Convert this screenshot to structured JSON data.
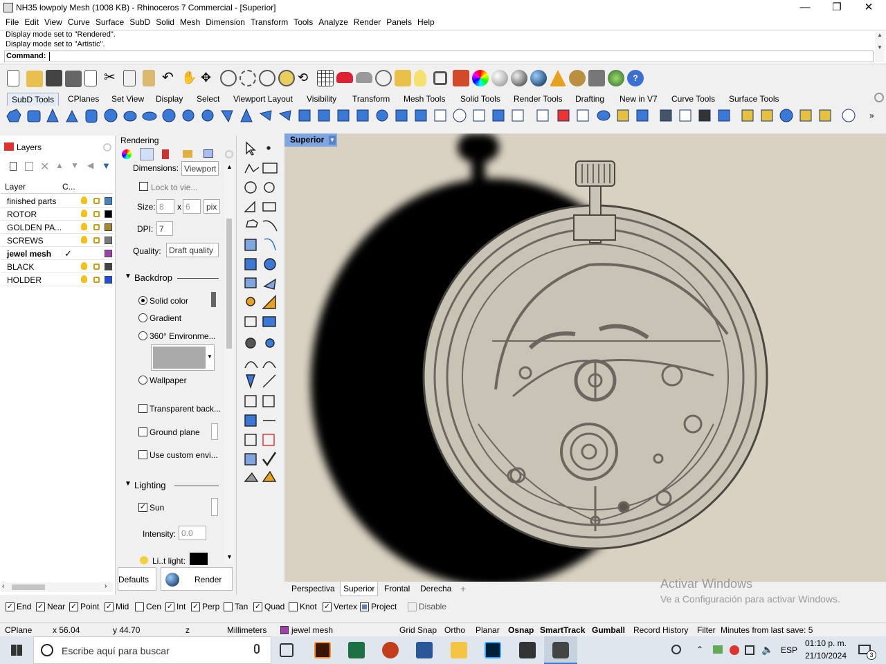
{
  "window": {
    "title": "NH35 lowpoly Mesh (1008 KB) - Rhinoceros 7 Commercial - [Superior]",
    "minimize_glyph": "—",
    "maximize_glyph": "❐",
    "close_glyph": "✕"
  },
  "menu": [
    "File",
    "Edit",
    "View",
    "Curve",
    "Surface",
    "SubD",
    "Solid",
    "Mesh",
    "Dimension",
    "Transform",
    "Tools",
    "Analyze",
    "Render",
    "Panels",
    "Help"
  ],
  "command": {
    "history": [
      "Display mode set to \"Rendered\".",
      "Display mode set to \"Artistic\"."
    ],
    "label": "Command:",
    "value": ""
  },
  "toolbar_tabs": [
    "SubD Tools",
    "CPlanes",
    "Set View",
    "Display",
    "Select",
    "Viewport Layout",
    "Visibility",
    "Transform",
    "Mesh Tools",
    "Solid Tools",
    "Render Tools",
    "Drafting",
    "New in V7",
    "Curve Tools",
    "Surface Tools"
  ],
  "layers": {
    "panel_title": "Layers",
    "col_layer": "Layer",
    "col_c": "C...",
    "items": [
      {
        "name": "finished parts",
        "color": "#3c87c4",
        "current": false
      },
      {
        "name": "ROTOR",
        "color": "#000000",
        "current": false
      },
      {
        "name": "GOLDEN PA...",
        "color": "#a88a2c",
        "current": false
      },
      {
        "name": "SCREWS",
        "color": "#7a7a7a",
        "current": false
      },
      {
        "name": "jewel mesh",
        "color": "#a040b0",
        "current": true
      },
      {
        "name": "BLACK",
        "color": "#444444",
        "current": false
      },
      {
        "name": "HOLDER",
        "color": "#1e50e0",
        "current": false
      }
    ],
    "check_glyph": "✓"
  },
  "rendering": {
    "title": "Rendering",
    "dimensions_label": "Dimensions:",
    "dimensions_value": "Viewport",
    "lock_label": "Lock to vie...",
    "size_label": "Size:",
    "size_w": "8",
    "size_x": "x",
    "size_h": "6",
    "size_unit": "pix",
    "dpi_label": "DPI:",
    "dpi_value": "7",
    "quality_label": "Quality:",
    "quality_value": "Draft quality",
    "backdrop_title": "Backdrop",
    "solid_color": "Solid color",
    "gradient": "Gradient",
    "env360": "360° Environme...",
    "wallpaper": "Wallpaper",
    "transparent": "Transparent back...",
    "ground": "Ground plane",
    "custom_env": "Use custom envi...",
    "lighting_title": "Lighting",
    "sun": "Sun",
    "sun_check": "✓",
    "intensity_label": "Intensity:",
    "intensity_value": "0.0",
    "light_label": "Li..t light:",
    "defaults_btn": "Defaults",
    "render_btn": "Render"
  },
  "viewport": {
    "label": "Superior",
    "tabs": [
      "Perspectiva",
      "Superior",
      "Frontal",
      "Derecha"
    ],
    "add_glyph": "+",
    "activate_title": "Activar Windows",
    "activate_sub": "Ve a Configuración para activar Windows."
  },
  "osnap": [
    {
      "label": "End",
      "checked": true
    },
    {
      "label": "Near",
      "checked": true
    },
    {
      "label": "Point",
      "checked": true
    },
    {
      "label": "Mid",
      "checked": true
    },
    {
      "label": "Cen",
      "checked": false
    },
    {
      "label": "Int",
      "checked": true
    },
    {
      "label": "Perp",
      "checked": true
    },
    {
      "label": "Tan",
      "checked": false
    },
    {
      "label": "Quad",
      "checked": true
    },
    {
      "label": "Knot",
      "checked": false
    },
    {
      "label": "Vertex",
      "checked": true
    },
    {
      "label": "Project",
      "checked": false
    },
    {
      "label": "Disable",
      "checked": false
    }
  ],
  "status": {
    "cplane": "CPlane",
    "x": "x 56.04",
    "y": "y 44.70",
    "z": "z",
    "units": "Millimeters",
    "layer": "jewel mesh",
    "grid_snap": "Grid Snap",
    "ortho": "Ortho",
    "planar": "Planar",
    "osnap": "Osnap",
    "smarttrack": "SmartTrack",
    "gumball": "Gumball",
    "record_history": "Record History",
    "filter": "Filter",
    "minutes": "Minutes from last save: 5"
  },
  "taskbar": {
    "search_placeholder": "Escribe aquí para buscar",
    "lang": "ESP",
    "time": "01:10 p. m.",
    "date": "21/10/2024",
    "notif_count": "3"
  }
}
